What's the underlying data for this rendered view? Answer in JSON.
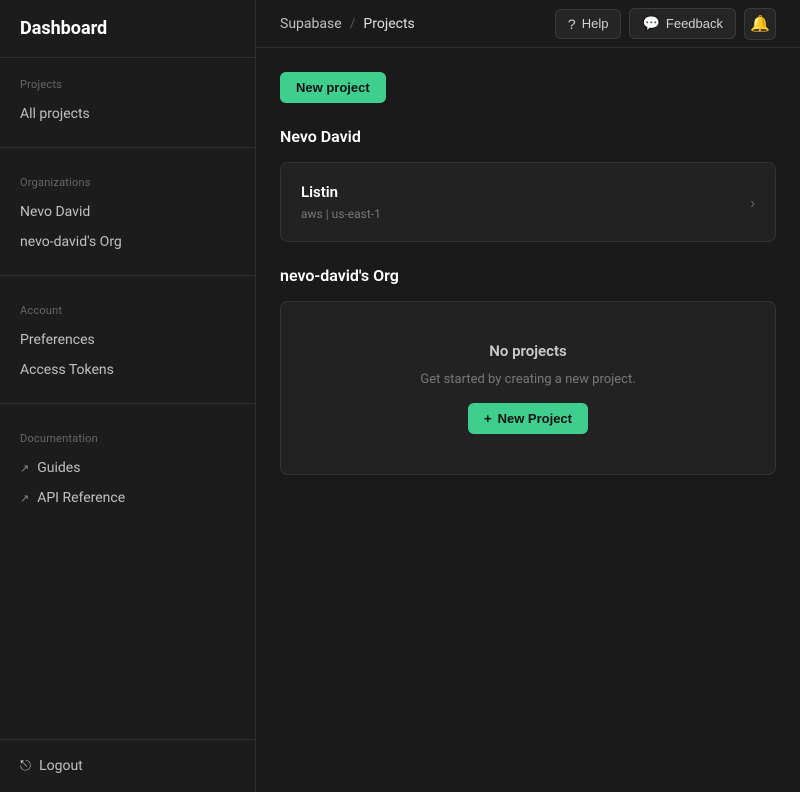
{
  "sidebar": {
    "title": "Dashboard",
    "sections": {
      "projects": {
        "label": "Projects",
        "items": [
          {
            "id": "all-projects",
            "label": "All projects"
          }
        ]
      },
      "organizations": {
        "label": "Organizations",
        "items": [
          {
            "id": "nevo-david",
            "label": "Nevo David"
          },
          {
            "id": "nevo-david-org",
            "label": "nevo-david's Org"
          }
        ]
      },
      "account": {
        "label": "Account",
        "items": [
          {
            "id": "preferences",
            "label": "Preferences"
          },
          {
            "id": "access-tokens",
            "label": "Access Tokens"
          }
        ]
      },
      "documentation": {
        "label": "Documentation",
        "items": [
          {
            "id": "guides",
            "label": "Guides"
          },
          {
            "id": "api-reference",
            "label": "API Reference"
          }
        ]
      }
    },
    "logout_label": "Logout"
  },
  "topbar": {
    "breadcrumb": {
      "root": "Supabase",
      "separator": "/",
      "current": "Projects"
    },
    "help_label": "Help",
    "feedback_label": "Feedback",
    "notification_icon": "bell-icon",
    "help_icon": "help-circle-icon",
    "feedback_icon": "chat-icon"
  },
  "main": {
    "new_project_label": "New project",
    "sections": [
      {
        "id": "nevo-david-section",
        "title": "Nevo David",
        "projects": [
          {
            "id": "listin",
            "name": "Listin",
            "meta": "aws | us-east-1"
          }
        ]
      },
      {
        "id": "nevo-david-org-section",
        "title": "nevo-david's Org",
        "projects": [],
        "empty": {
          "title": "No projects",
          "subtitle": "Get started by creating a new project.",
          "cta_label": "New Project"
        }
      }
    ]
  }
}
